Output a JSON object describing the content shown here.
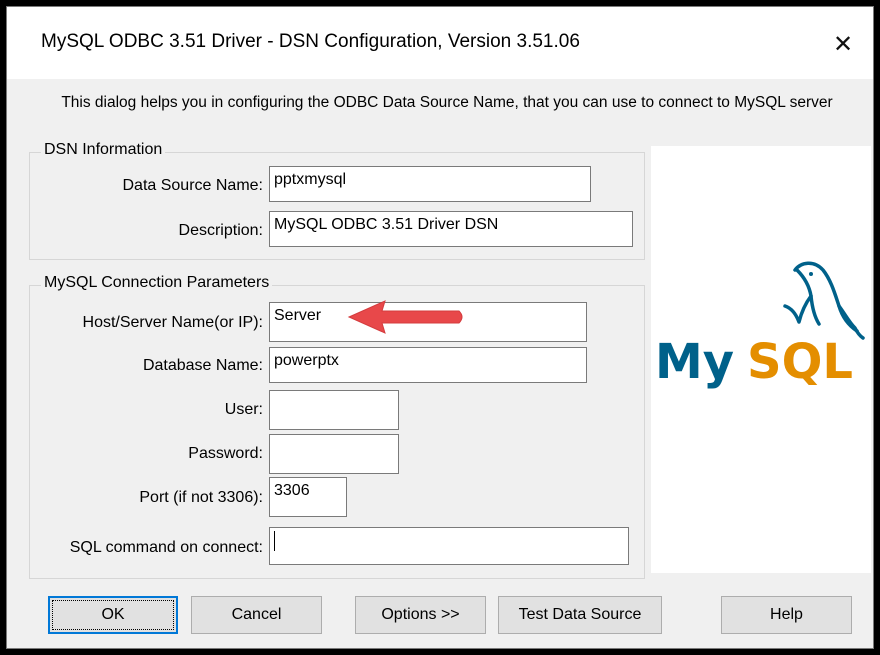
{
  "window": {
    "title": "MySQL ODBC 3.51 Driver - DSN Configuration, Version 3.51.06",
    "close_glyph": "✕"
  },
  "intro_text": "This dialog helps you in configuring the ODBC Data Source Name, that you can use to connect to MySQL server",
  "dsn_group": {
    "title": "DSN Information",
    "data_source_name": {
      "label": "Data Source Name:",
      "value": "pptxmysql"
    },
    "description": {
      "label": "Description:",
      "value": "MySQL ODBC 3.51 Driver DSN"
    }
  },
  "connection_group": {
    "title": "MySQL Connection Parameters",
    "host": {
      "label": "Host/Server Name(or IP):",
      "value": "Server"
    },
    "database": {
      "label": "Database Name:",
      "value": "powerptx"
    },
    "user": {
      "label": "User:",
      "value": ""
    },
    "password": {
      "label": "Password:",
      "value": ""
    },
    "port": {
      "label": "Port (if not 3306):",
      "value": "3306"
    },
    "sql_command": {
      "label": "SQL command on connect:",
      "value": ""
    }
  },
  "logo": {
    "text_my": "My",
    "text_sql": "SQL",
    "icon": "dolphin-icon",
    "color_my": "#00618a",
    "color_sql": "#e48e00"
  },
  "annotation": {
    "icon": "arrow-left-icon",
    "color": "#e8484a"
  },
  "buttons": {
    "ok": "OK",
    "cancel": "Cancel",
    "options": "Options >>",
    "test": "Test Data Source",
    "help": "Help"
  }
}
